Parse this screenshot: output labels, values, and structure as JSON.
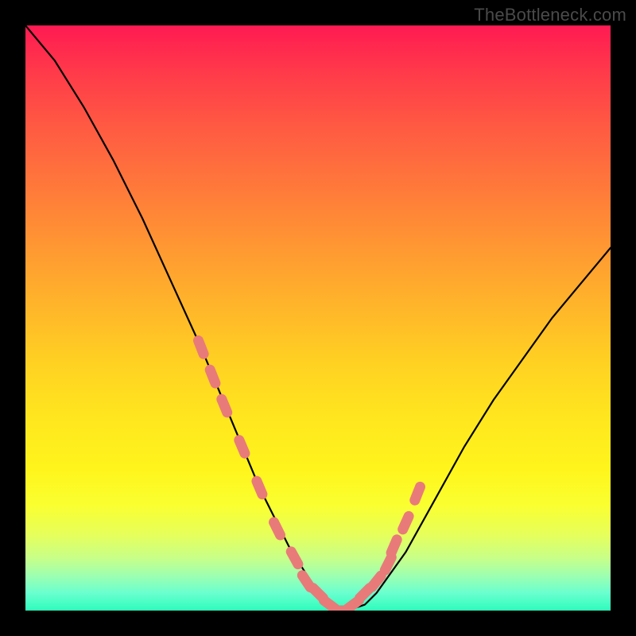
{
  "watermark": "TheBottleneck.com",
  "chart_data": {
    "type": "line",
    "title": "",
    "xlabel": "",
    "ylabel": "",
    "xlim": [
      0,
      100
    ],
    "ylim": [
      0,
      100
    ],
    "series": [
      {
        "name": "bottleneck-curve",
        "x": [
          0,
          5,
          10,
          15,
          20,
          25,
          30,
          35,
          40,
          45,
          50,
          52,
          55,
          58,
          60,
          65,
          70,
          75,
          80,
          85,
          90,
          95,
          100
        ],
        "y": [
          100,
          94,
          86,
          77,
          67,
          56,
          45,
          33,
          21,
          11,
          3,
          1,
          0,
          1,
          3,
          10,
          19,
          28,
          36,
          43,
          50,
          56,
          62
        ]
      }
    ],
    "markers": {
      "name": "highlighted-dots",
      "color": "#e97a7a",
      "x": [
        30,
        32,
        34,
        37,
        40,
        43,
        46,
        48,
        50,
        52,
        54,
        56,
        58,
        60,
        62,
        63,
        65,
        67
      ],
      "y": [
        45,
        40,
        35,
        28,
        21,
        14,
        9,
        5,
        3,
        1,
        0,
        1,
        3,
        5,
        8,
        11,
        15,
        20
      ]
    }
  }
}
